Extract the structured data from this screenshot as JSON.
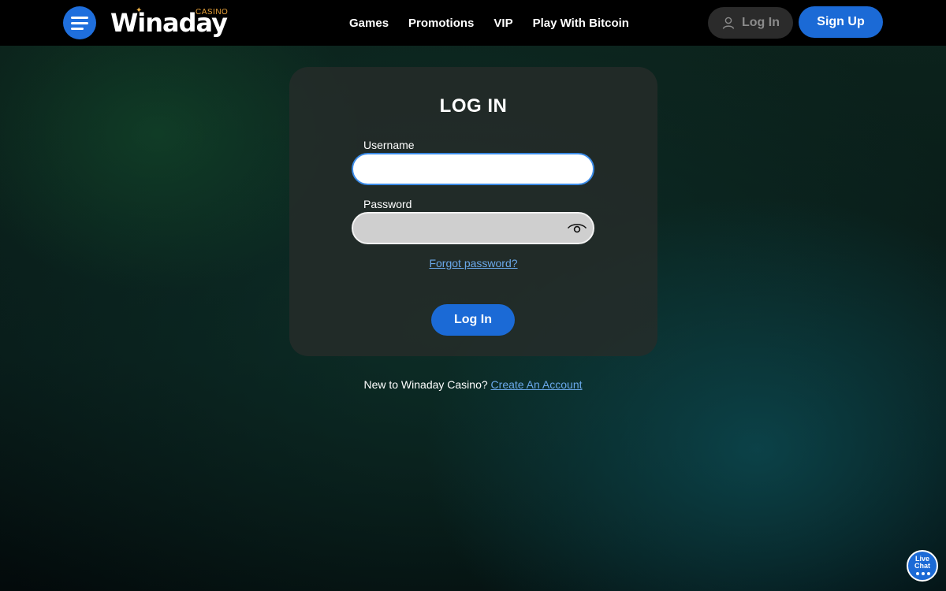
{
  "brand": {
    "name": "Winaday",
    "sub": "CASINO"
  },
  "nav": {
    "items": [
      {
        "label": "Games"
      },
      {
        "label": "Promotions"
      },
      {
        "label": "VIP"
      },
      {
        "label": "Play With Bitcoin"
      }
    ]
  },
  "header": {
    "login_label": "Log In",
    "signup_label": "Sign Up"
  },
  "login_form": {
    "title": "LOG IN",
    "username_label": "Username",
    "username_value": "",
    "password_label": "Password",
    "password_value": "",
    "forgot_label": "Forgot password?",
    "submit_label": "Log In"
  },
  "footer_prompt": {
    "text": "New to Winaday Casino?",
    "link_label": "Create An Account"
  },
  "live_chat": {
    "line1": "Live",
    "line2": "Chat"
  },
  "colors": {
    "accent": "#1b6ad6",
    "link": "#6aa8ea",
    "brand_sub": "#e8a23a"
  },
  "icons": {
    "menu": "hamburger-icon",
    "user": "user-icon",
    "password_toggle": "eye-icon",
    "chat": "chat-bubble-icon"
  }
}
